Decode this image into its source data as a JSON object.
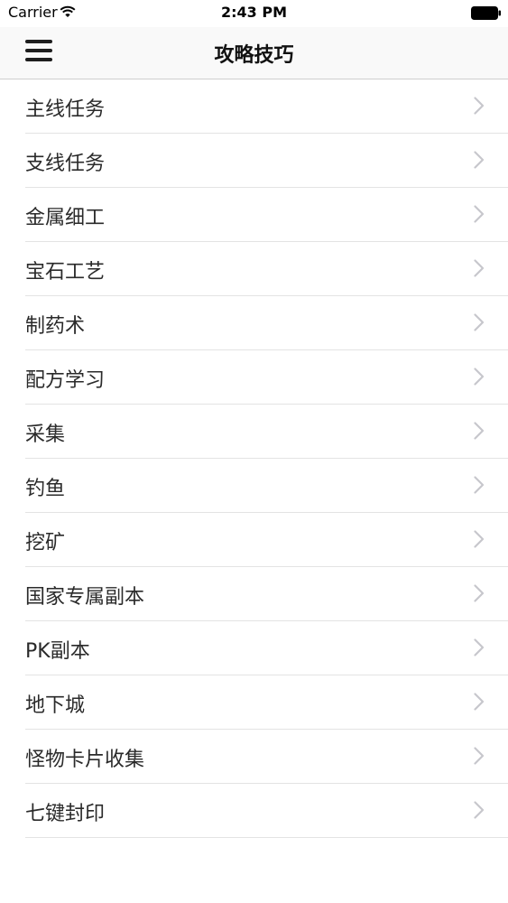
{
  "status_bar": {
    "carrier": "Carrier",
    "time": "2:43 PM"
  },
  "nav": {
    "title": "攻略技巧",
    "menu_icon": "hamburger-menu-icon"
  },
  "list": {
    "items": [
      {
        "label": "主线任务"
      },
      {
        "label": "支线任务"
      },
      {
        "label": "金属细工"
      },
      {
        "label": "宝石工艺"
      },
      {
        "label": "制药术"
      },
      {
        "label": "配方学习"
      },
      {
        "label": "采集"
      },
      {
        "label": "钓鱼"
      },
      {
        "label": "挖矿"
      },
      {
        "label": "国家专属副本"
      },
      {
        "label": "PK副本"
      },
      {
        "label": "地下城"
      },
      {
        "label": "怪物卡片收集"
      },
      {
        "label": "七键封印"
      }
    ],
    "chevron_icon": "chevron-right-icon"
  },
  "colors": {
    "nav_background": "#f9f9f9",
    "separator": "#e3e3e3",
    "chevron": "#c7c7cc",
    "text": "#2a2a2a"
  }
}
